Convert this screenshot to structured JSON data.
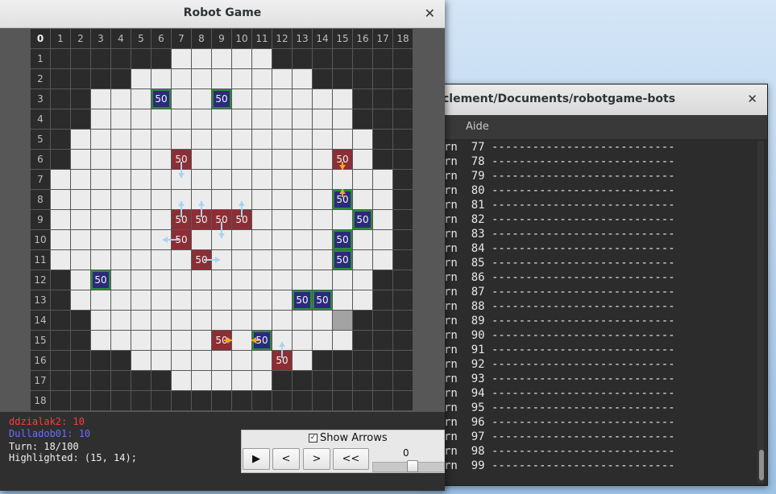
{
  "terminal": {
    "title": "clement/Documents/robotgame-bots",
    "menu": [
      "al",
      "Aide"
    ],
    "lines": [
      "rn  77 ---------------------------",
      "rn  78 ---------------------------",
      "rn  79 ---------------------------",
      "rn  80 ---------------------------",
      "rn  81 ---------------------------",
      "rn  82 ---------------------------",
      "rn  83 ---------------------------",
      "rn  84 ---------------------------",
      "rn  85 ---------------------------",
      "rn  86 ---------------------------",
      "rn  87 ---------------------------",
      "rn  88 ---------------------------",
      "rn  89 ---------------------------",
      "rn  90 ---------------------------",
      "rn  91 ---------------------------",
      "rn  92 ---------------------------",
      "rn  93 ---------------------------",
      "rn  94 ---------------------------",
      "rn  95 ---------------------------",
      "rn  96 ---------------------------",
      "rn  97 ---------------------------",
      "rn  98 ---------------------------",
      "rn  99 ---------------------------"
    ]
  },
  "game": {
    "title": "Robot Game",
    "grid_size": 19,
    "column_labels": [
      "0",
      "1",
      "2",
      "3",
      "4",
      "5",
      "6",
      "7",
      "8",
      "9",
      "10",
      "11",
      "12",
      "13",
      "14",
      "15",
      "16",
      "17",
      "18"
    ],
    "row_labels": [
      "1",
      "2",
      "3",
      "4",
      "5",
      "6",
      "7",
      "8",
      "9",
      "10",
      "11",
      "12",
      "13",
      "14",
      "15",
      "16",
      "17",
      "18"
    ],
    "floor_ranges": [
      null,
      [
        7,
        11
      ],
      [
        5,
        13
      ],
      [
        3,
        15
      ],
      [
        3,
        15
      ],
      [
        2,
        16
      ],
      [
        2,
        16
      ],
      [
        1,
        17
      ],
      [
        1,
        17
      ],
      [
        1,
        17
      ],
      [
        1,
        17
      ],
      [
        1,
        17
      ],
      [
        2,
        16
      ],
      [
        2,
        16
      ],
      [
        3,
        15
      ],
      [
        3,
        15
      ],
      [
        5,
        13
      ],
      [
        7,
        11
      ],
      null
    ],
    "highlighted_cell": [
      15,
      14
    ],
    "robots": [
      {
        "x": 6,
        "y": 3,
        "hp": "50",
        "team": "blue"
      },
      {
        "x": 9,
        "y": 3,
        "hp": "50",
        "team": "blue"
      },
      {
        "x": 7,
        "y": 6,
        "hp": "50",
        "team": "red"
      },
      {
        "x": 15,
        "y": 6,
        "hp": "50",
        "team": "red"
      },
      {
        "x": 15,
        "y": 8,
        "hp": "50",
        "team": "blue"
      },
      {
        "x": 7,
        "y": 9,
        "hp": "50",
        "team": "red"
      },
      {
        "x": 8,
        "y": 9,
        "hp": "50",
        "team": "red"
      },
      {
        "x": 9,
        "y": 9,
        "hp": "50",
        "team": "red"
      },
      {
        "x": 10,
        "y": 9,
        "hp": "50",
        "team": "red"
      },
      {
        "x": 16,
        "y": 9,
        "hp": "50",
        "team": "blue"
      },
      {
        "x": 7,
        "y": 10,
        "hp": "50",
        "team": "red"
      },
      {
        "x": 15,
        "y": 10,
        "hp": "50",
        "team": "blue"
      },
      {
        "x": 8,
        "y": 11,
        "hp": "50",
        "team": "red"
      },
      {
        "x": 15,
        "y": 11,
        "hp": "50",
        "team": "blue"
      },
      {
        "x": 3,
        "y": 12,
        "hp": "50",
        "team": "blue"
      },
      {
        "x": 13,
        "y": 13,
        "hp": "50",
        "team": "blue"
      },
      {
        "x": 14,
        "y": 13,
        "hp": "50",
        "team": "blue"
      },
      {
        "x": 9,
        "y": 15,
        "hp": "50",
        "team": "red"
      },
      {
        "x": 11,
        "y": 15,
        "hp": "50",
        "team": "blue"
      },
      {
        "x": 12,
        "y": 16,
        "hp": "50",
        "team": "red"
      }
    ],
    "move_arrows": [
      {
        "x": 7,
        "y": 6,
        "dir": "down"
      },
      {
        "x": 7,
        "y": 9,
        "dir": "up"
      },
      {
        "x": 8,
        "y": 9,
        "dir": "up"
      },
      {
        "x": 9,
        "y": 9,
        "dir": "down"
      },
      {
        "x": 10,
        "y": 9,
        "dir": "up"
      },
      {
        "x": 7,
        "y": 10,
        "dir": "left"
      },
      {
        "x": 8,
        "y": 11,
        "dir": "right"
      },
      {
        "x": 12,
        "y": 16,
        "dir": "up"
      }
    ],
    "attack_arrows": [
      {
        "x": 15,
        "y": 6,
        "dir": "down"
      },
      {
        "x": 15,
        "y": 8,
        "dir": "up"
      },
      {
        "x": 9,
        "y": 15,
        "dir": "right"
      },
      {
        "x": 11,
        "y": 15,
        "dir": "left"
      }
    ],
    "colors": {
      "wall": "#2b2b2b",
      "floor": "#ececec",
      "red_robot": "#8b2e35",
      "blue_robot": "#2b2a7b",
      "blue_border": "#2e8b3a",
      "move_arrow": "#a8d4ee",
      "attack_arrow": "#f5a623",
      "player1": "#ff3b3b",
      "player2": "#6d6dff"
    }
  },
  "status": {
    "player1": "ddzialak2: 10",
    "player2": "Dulladob01: 10",
    "turn": "Turn: 18/100",
    "highlighted": "Highlighted: (15, 14);"
  },
  "controls": {
    "show_arrows_label": "Show Arrows",
    "show_arrows_checked": true,
    "play_label": "▶",
    "prev_label": "<",
    "next_label": ">",
    "rewind_label": "<<",
    "slider_value": "0"
  }
}
